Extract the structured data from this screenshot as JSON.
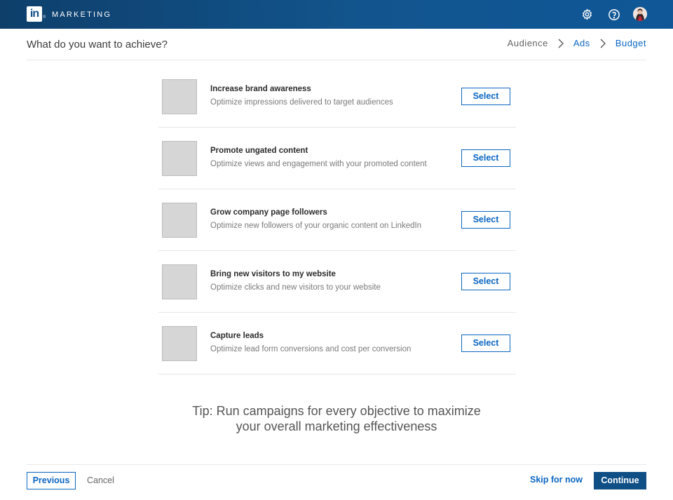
{
  "header": {
    "logo_text": "in",
    "brand": "MARKETING",
    "icons": [
      "gear-icon",
      "help-icon",
      "avatar"
    ]
  },
  "page": {
    "title": "What do you want to achieve?"
  },
  "steps": [
    {
      "label": "Audience",
      "active": false
    },
    {
      "label": "Ads",
      "active": true
    },
    {
      "label": "Budget",
      "active": true
    }
  ],
  "objectives": [
    {
      "title": "Increase brand awareness",
      "description": "Optimize impressions delivered to target audiences",
      "button": "Select"
    },
    {
      "title": "Promote ungated content",
      "description": "Optimize views and engagement with your promoted content",
      "button": "Select"
    },
    {
      "title": "Grow company page followers",
      "description": "Optimize new followers of your organic content on LinkedIn",
      "button": "Select"
    },
    {
      "title": "Bring new visitors to my website",
      "description": "Optimize clicks and new visitors to your website",
      "button": "Select"
    },
    {
      "title": "Capture leads",
      "description": "Optimize lead form conversions and cost per conversion",
      "button": "Select"
    }
  ],
  "tip": {
    "line1": "Tip: Run campaigns for every objective to maximize",
    "line2": "your overall marketing effectiveness"
  },
  "footer": {
    "previous": "Previous",
    "cancel": "Cancel",
    "skip": "Skip for now",
    "continue": "Continue"
  },
  "colors": {
    "topbar": "#12558e",
    "accent": "#0a66c2",
    "primary_button": "#0f4f86"
  }
}
